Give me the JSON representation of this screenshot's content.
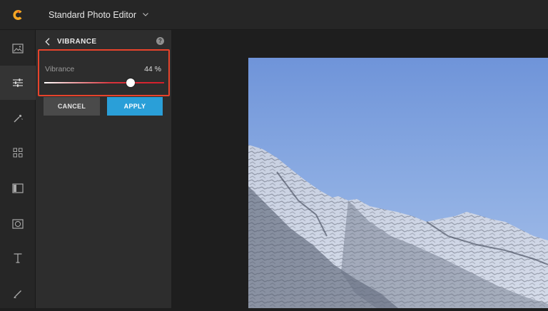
{
  "topbar": {
    "app_title": "Standard Photo Editor",
    "logo_icon": "brand-c-logo",
    "dropdown_icon": "chevron-down-icon"
  },
  "rail": {
    "items": [
      {
        "icon": "image-icon",
        "active": false
      },
      {
        "icon": "sliders-icon",
        "active": true
      },
      {
        "icon": "magic-wand-icon",
        "active": false
      },
      {
        "icon": "grid-icon",
        "active": false
      },
      {
        "icon": "frame-icon",
        "active": false
      },
      {
        "icon": "vignette-icon",
        "active": false
      },
      {
        "icon": "text-icon",
        "active": false
      },
      {
        "icon": "brush-icon",
        "active": false
      }
    ]
  },
  "panel": {
    "title": "VIBRANCE",
    "help_label": "?",
    "vibrance": {
      "label": "Vibrance",
      "value": 44,
      "value_text": "44 %",
      "min": -100,
      "max": 100
    },
    "cancel_label": "CANCEL",
    "apply_label": "APPLY"
  },
  "colors": {
    "accent": "#2a9fd8",
    "highlight": "#e8432b",
    "logo": "#f5a623"
  }
}
